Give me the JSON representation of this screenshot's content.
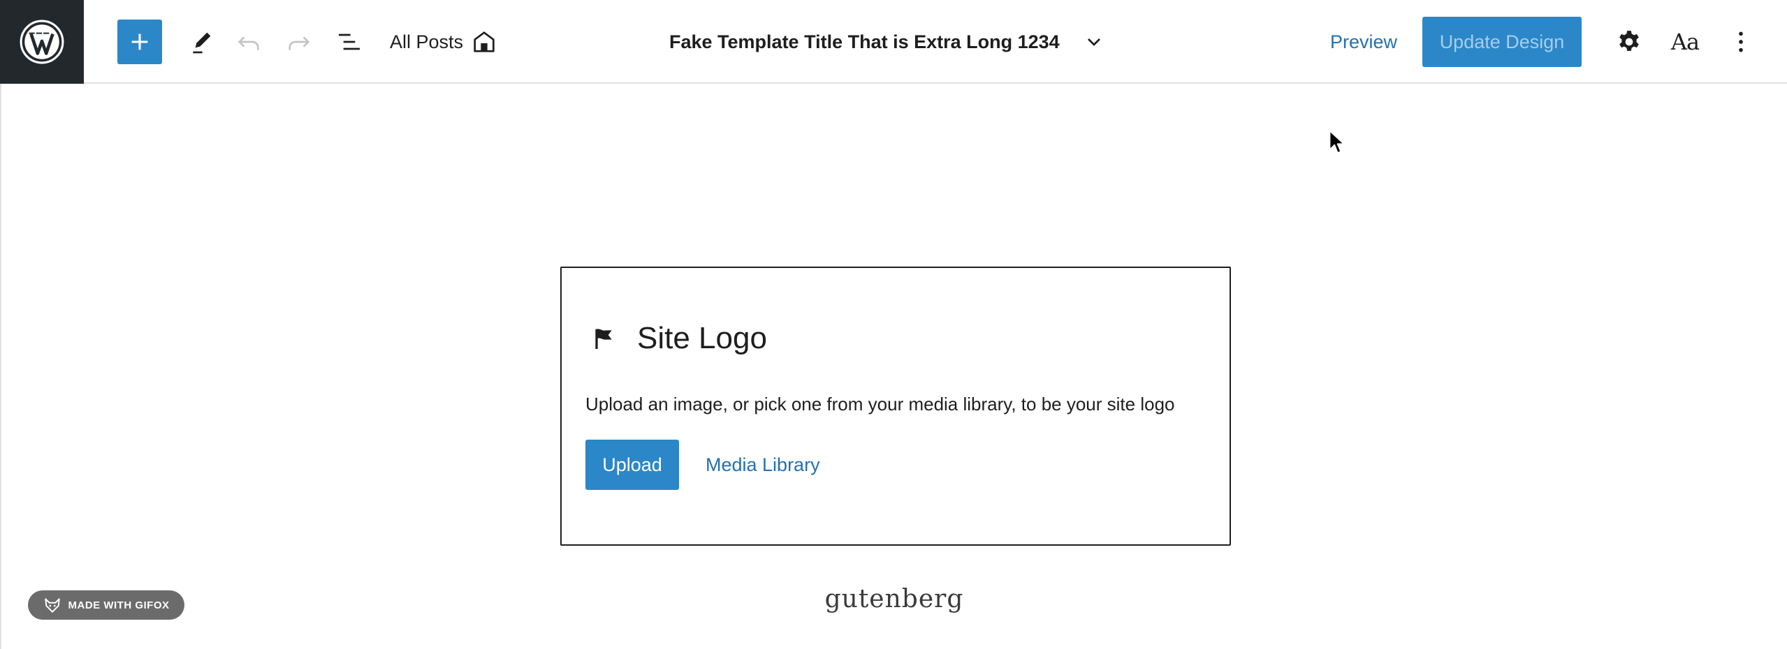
{
  "toolbar": {
    "all_posts_label": "All Posts",
    "template_title": "Fake Template Title That is Extra Long 1234",
    "preview_label": "Preview",
    "update_label": "Update Design",
    "styles_glyph": "Aa",
    "icons": {
      "logo": "wordpress-logo",
      "add": "plus-icon",
      "edit": "pencil-icon",
      "undo": "undo-icon",
      "redo": "redo-icon",
      "list_view": "list-view-icon",
      "home": "home-icon",
      "chevron": "chevron-down-icon",
      "settings": "gear-icon",
      "more": "more-vertical-icon"
    }
  },
  "placeholder": {
    "title": "Site Logo",
    "icon": "flag-icon",
    "instructions": "Upload an image, or pick one from your media library, to be your site logo",
    "upload_label": "Upload",
    "media_library_label": "Media Library"
  },
  "site": {
    "title": "gutenberg"
  },
  "badge": {
    "label": "MADE WITH GIFOX",
    "icon": "fox-icon"
  },
  "colors": {
    "accent": "#2b87c8",
    "link": "#2271b1",
    "logo_bg": "#23282d",
    "update_text": "#a9cde8"
  }
}
